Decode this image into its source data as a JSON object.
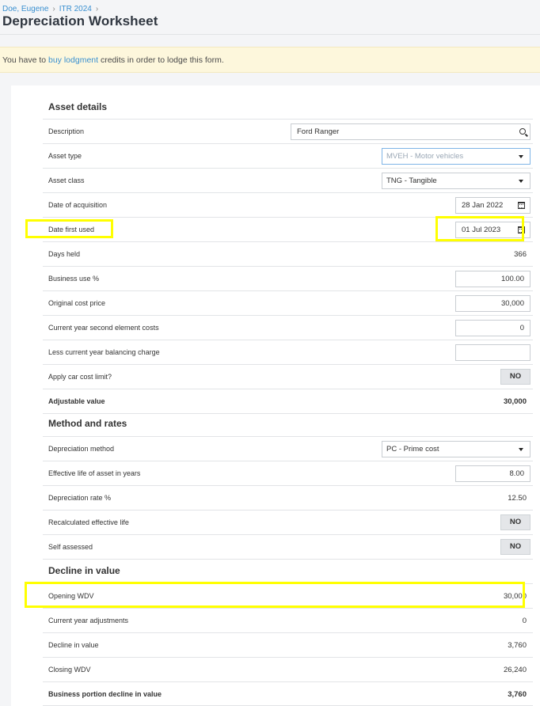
{
  "breadcrumb": {
    "client": "Doe, Eugene",
    "return": "ITR 2024",
    "sep": "›"
  },
  "page_title": "Depreciation Worksheet",
  "banner": {
    "prefix": "You have to ",
    "link": "buy lodgment",
    "suffix": " credits in order to lodge this form."
  },
  "asset_details": {
    "title": "Asset details",
    "description": {
      "label": "Description",
      "value": "Ford Ranger"
    },
    "asset_type": {
      "label": "Asset type",
      "value": "MVEH - Motor vehicles"
    },
    "asset_class": {
      "label": "Asset class",
      "value": "TNG - Tangible"
    },
    "date_of_acquisition": {
      "label": "Date of acquisition",
      "value": "28 Jan 2022"
    },
    "date_first_used": {
      "label": "Date first used",
      "value": "01 Jul 2023"
    },
    "days_held": {
      "label": "Days held",
      "value": "366"
    },
    "business_use": {
      "label": "Business use %",
      "value": "100.00"
    },
    "original_cost": {
      "label": "Original cost price",
      "value": "30,000"
    },
    "second_element": {
      "label": "Current year second element costs",
      "value": "0"
    },
    "balancing_charge": {
      "label": "Less current year balancing charge",
      "value": ""
    },
    "car_cost_limit": {
      "label": "Apply car cost limit?",
      "value": "NO"
    },
    "adjustable_value": {
      "label": "Adjustable value",
      "value": "30,000"
    }
  },
  "method_rates": {
    "title": "Method and rates",
    "method": {
      "label": "Depreciation method",
      "value": "PC - Prime cost"
    },
    "effective_life": {
      "label": "Effective life of asset in years",
      "value": "8.00"
    },
    "rate": {
      "label": "Depreciation rate %",
      "value": "12.50"
    },
    "recalculated": {
      "label": "Recalculated effective life",
      "value": "NO"
    },
    "self_assessed": {
      "label": "Self assessed",
      "value": "NO"
    }
  },
  "decline": {
    "title": "Decline in value",
    "opening_wdv": {
      "label": "Opening WDV",
      "value": "30,000"
    },
    "adjustments": {
      "label": "Current year adjustments",
      "value": "0"
    },
    "decline_in_value": {
      "label": "Decline in value",
      "value": "3,760"
    },
    "closing_wdv": {
      "label": "Closing WDV",
      "value": "26,240"
    },
    "business_portion": {
      "label": "Business portion decline in value",
      "value": "3,760"
    }
  },
  "colors": {
    "link": "#3a90d0",
    "banner_bg": "#fdf7dc",
    "highlight": "#ffff00"
  }
}
